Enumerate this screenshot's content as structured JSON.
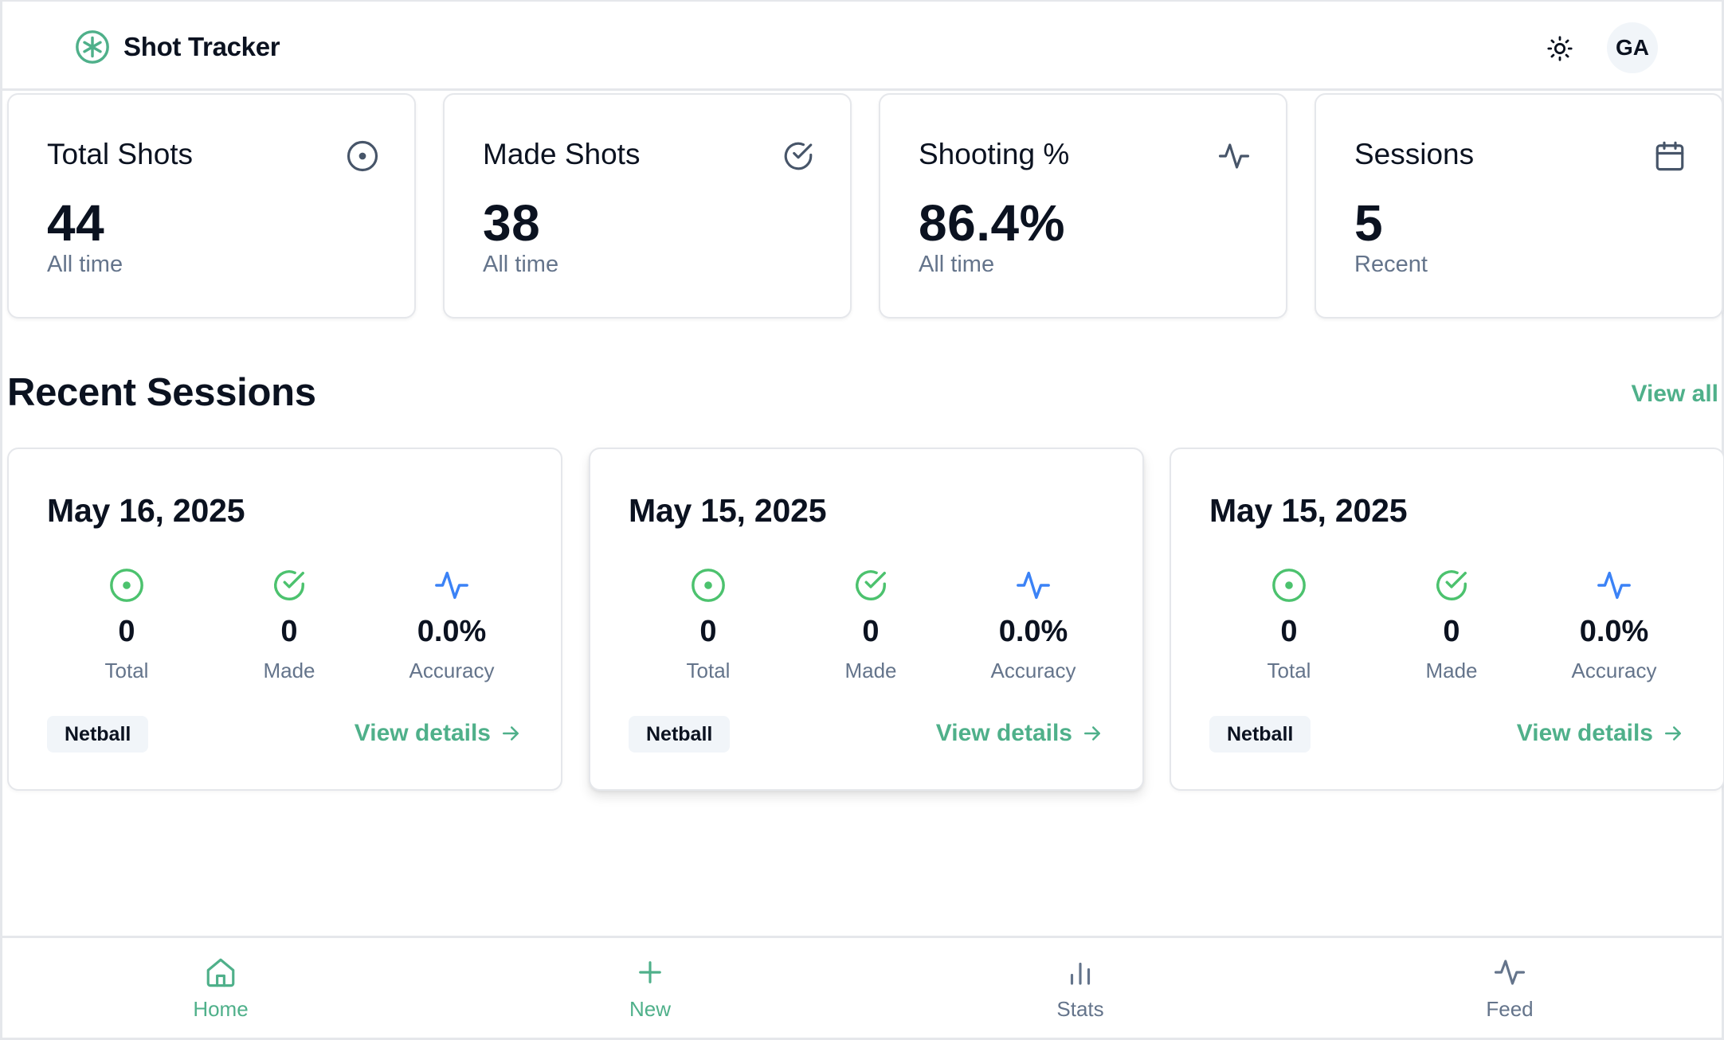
{
  "app": {
    "name": "Shot Tracker",
    "avatar_initials": "GA"
  },
  "colors": {
    "accent": "#4fb08a",
    "green": "#4cc26e",
    "blue": "#3b82f6",
    "muted": "#64748b"
  },
  "stats": [
    {
      "title": "Total Shots",
      "value": "44",
      "sub": "All time",
      "icon": "target-icon"
    },
    {
      "title": "Made Shots",
      "value": "38",
      "sub": "All time",
      "icon": "check-circle-icon"
    },
    {
      "title": "Shooting %",
      "value": "86.4%",
      "sub": "All time",
      "icon": "activity-icon"
    },
    {
      "title": "Sessions",
      "value": "5",
      "sub": "Recent",
      "icon": "calendar-icon"
    }
  ],
  "recent": {
    "title": "Recent Sessions",
    "view_all": "View all",
    "sessions": [
      {
        "date": "May 16, 2025",
        "total": "0",
        "made": "0",
        "accuracy": "0.0%",
        "labels": {
          "total": "Total",
          "made": "Made",
          "accuracy": "Accuracy"
        },
        "tag": "Netball",
        "details": "View details"
      },
      {
        "date": "May 15, 2025",
        "total": "0",
        "made": "0",
        "accuracy": "0.0%",
        "labels": {
          "total": "Total",
          "made": "Made",
          "accuracy": "Accuracy"
        },
        "tag": "Netball",
        "details": "View details"
      },
      {
        "date": "May 15, 2025",
        "total": "0",
        "made": "0",
        "accuracy": "0.0%",
        "labels": {
          "total": "Total",
          "made": "Made",
          "accuracy": "Accuracy"
        },
        "tag": "Netball",
        "details": "View details"
      }
    ]
  },
  "nav": [
    {
      "label": "Home",
      "icon": "home-icon",
      "active": true
    },
    {
      "label": "New",
      "icon": "plus-icon",
      "active": false
    },
    {
      "label": "Stats",
      "icon": "bar-chart-icon",
      "active": false
    },
    {
      "label": "Feed",
      "icon": "activity-icon",
      "active": false
    }
  ]
}
